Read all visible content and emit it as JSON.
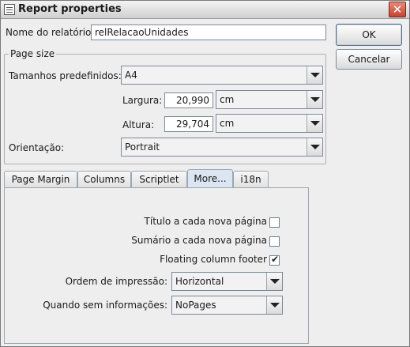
{
  "window": {
    "title": "Report properties",
    "close_glyph": "✕"
  },
  "form": {
    "report_name_label": "Nome do relatório:",
    "report_name_value": "relRelacaoUnidades"
  },
  "buttons": {
    "ok": "OK",
    "cancel": "Cancelar"
  },
  "page_size": {
    "group_label": "Page size",
    "preset_label": "Tamanhos predefinidos:",
    "preset_value": "A4",
    "width_label": "Largura:",
    "width_value": "20,990",
    "width_unit": "cm",
    "height_label": "Altura:",
    "height_value": "29,704",
    "height_unit": "cm",
    "orientation_label": "Orientação:",
    "orientation_value": "Portrait"
  },
  "tabs": [
    {
      "label": "Page Margin",
      "active": false
    },
    {
      "label": "Columns",
      "active": false
    },
    {
      "label": "Scriptlet",
      "active": false
    },
    {
      "label": "More...",
      "active": true
    },
    {
      "label": "i18n",
      "active": false
    }
  ],
  "more_panel": {
    "title_each_page_label": "Título a cada nova página",
    "title_each_page_checked": false,
    "summary_each_page_label": "Sumário a cada nova página",
    "summary_each_page_checked": false,
    "floating_footer_label": "Floating column footer",
    "floating_footer_checked": true,
    "check_glyph": "✔",
    "print_order_label": "Ordem de impressão:",
    "print_order_value": "Horizontal",
    "when_no_data_label": "Quando sem informações:",
    "when_no_data_value": "NoPages"
  },
  "icons": {
    "title_icon": "window-icon",
    "close_icon": "close-icon",
    "dropdown_icon": "chevron-down-icon"
  }
}
